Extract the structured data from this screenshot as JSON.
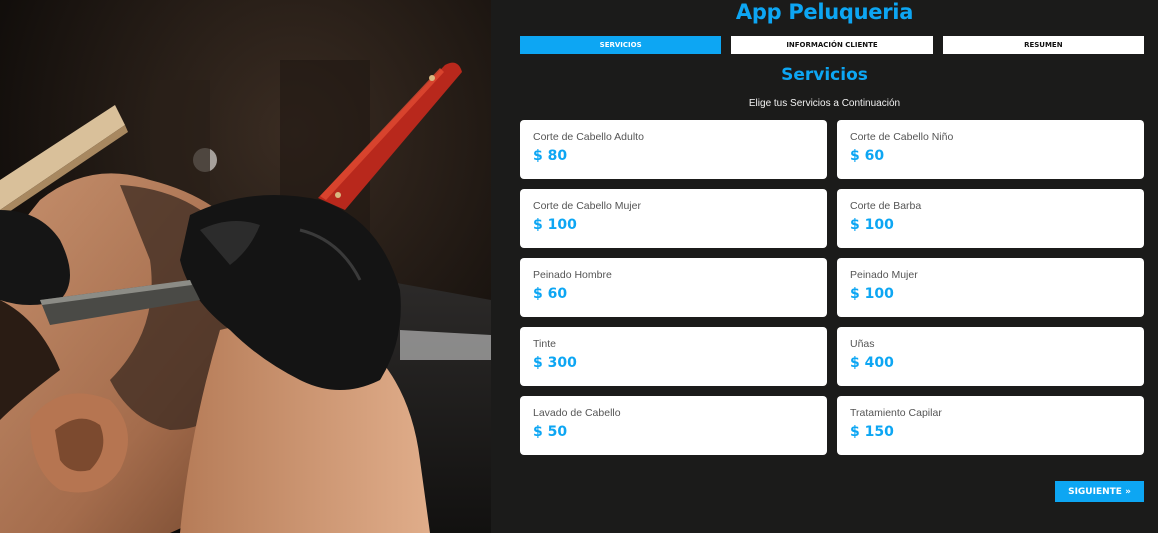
{
  "app": {
    "title": "App Peluqueria"
  },
  "tabs": [
    {
      "label": "Servicios",
      "active": true
    },
    {
      "label": "Información Cliente",
      "active": false
    },
    {
      "label": "Resumen",
      "active": false
    }
  ],
  "section": {
    "title": "Servicios",
    "subtitle": "Elige tus Servicios a Continuación"
  },
  "services": [
    {
      "name": "Corte de Cabello Adulto",
      "price": "$ 80"
    },
    {
      "name": "Corte de Cabello Niño",
      "price": "$ 60"
    },
    {
      "name": "Corte de Cabello Mujer",
      "price": "$ 100"
    },
    {
      "name": "Corte de Barba",
      "price": "$ 100"
    },
    {
      "name": "Peinado Hombre",
      "price": "$ 60"
    },
    {
      "name": "Peinado Mujer",
      "price": "$ 100"
    },
    {
      "name": "Tinte",
      "price": "$ 300"
    },
    {
      "name": "Uñas",
      "price": "$ 400"
    },
    {
      "name": "Lavado de Cabello",
      "price": "$ 50"
    },
    {
      "name": "Tratamiento Capilar",
      "price": "$ 150"
    }
  ],
  "next_button": {
    "label": "Siguiente »"
  },
  "colors": {
    "accent": "#0da6f3",
    "background": "#1b1b1a",
    "card": "#ffffff"
  },
  "hero": {
    "icon": "barber-shaving-photo"
  }
}
